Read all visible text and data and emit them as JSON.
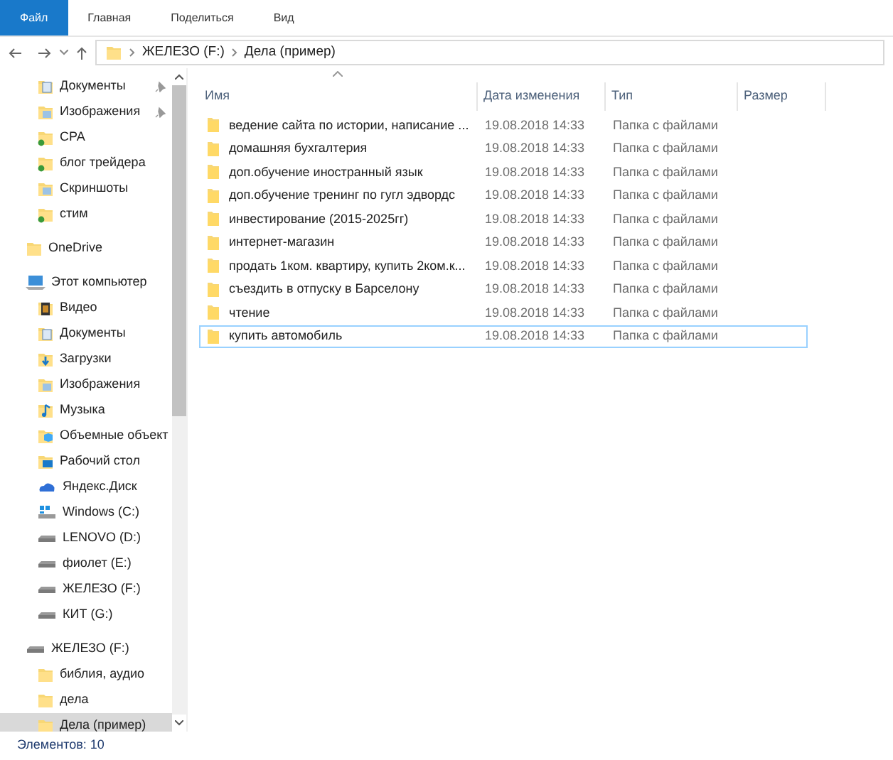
{
  "ribbon_tabs": [
    {
      "label": "Файл",
      "selected": true
    },
    {
      "label": "Главная",
      "selected": false
    },
    {
      "label": "Поделиться",
      "selected": false
    },
    {
      "label": "Вид",
      "selected": false
    }
  ],
  "address_bar": {
    "path": [
      "ЖЕЛЕЗО (F:)",
      "Дела (пример)"
    ]
  },
  "sidebar": {
    "quick_access": [
      {
        "label": "Документы",
        "kind": "docs",
        "pinned": true
      },
      {
        "label": "Изображения",
        "kind": "images",
        "pinned": true
      },
      {
        "label": "CPA",
        "kind": "synced",
        "pinned": false
      },
      {
        "label": "блог трейдера",
        "kind": "synced",
        "pinned": false
      },
      {
        "label": "Скриншоты",
        "kind": "images",
        "pinned": false
      },
      {
        "label": "стим",
        "kind": "synced",
        "pinned": false
      }
    ],
    "tree": [
      {
        "label": "OneDrive",
        "kind": "folder",
        "selected": false
      },
      {
        "label": "Этот компьютер",
        "kind": "pc",
        "selected": false,
        "children": [
          {
            "label": "Видео",
            "kind": "video",
            "selected": false
          },
          {
            "label": "Документы",
            "kind": "docs",
            "selected": false
          },
          {
            "label": "Загрузки",
            "kind": "downloads",
            "selected": false
          },
          {
            "label": "Изображения",
            "kind": "images",
            "selected": false
          },
          {
            "label": "Музыка",
            "kind": "music",
            "selected": false
          },
          {
            "label": "Объемные объект",
            "kind": "objects",
            "selected": false
          },
          {
            "label": "Рабочий стол",
            "kind": "desktop",
            "selected": false
          },
          {
            "label": "Яндекс.Диск",
            "kind": "cloud",
            "selected": false
          },
          {
            "label": "Windows (C:)",
            "kind": "windrive",
            "selected": false
          },
          {
            "label": "LENOVO (D:)",
            "kind": "drive",
            "selected": false
          },
          {
            "label": "фиолет (E:)",
            "kind": "drive",
            "selected": false
          },
          {
            "label": "ЖЕЛЕЗО (F:)",
            "kind": "drive",
            "selected": false
          },
          {
            "label": "КИТ (G:)",
            "kind": "drive",
            "selected": false
          }
        ]
      },
      {
        "label": "ЖЕЛЕЗО (F:)",
        "kind": "drive",
        "selected": false,
        "children": [
          {
            "label": "библия, аудио",
            "kind": "folder",
            "selected": false
          },
          {
            "label": "дела",
            "kind": "folder",
            "selected": false
          },
          {
            "label": "Дела (пример)",
            "kind": "folder",
            "selected": true
          }
        ]
      }
    ]
  },
  "file_list": {
    "columns": [
      "Имя",
      "Дата изменения",
      "Тип",
      "Размер"
    ],
    "rows": [
      {
        "name": "ведение сайта по истории, написание ...",
        "date": "19.08.2018 14:33",
        "type": "Папка с файлами",
        "focused": false
      },
      {
        "name": "домашняя бухгалтерия",
        "date": "19.08.2018 14:33",
        "type": "Папка с файлами",
        "focused": false
      },
      {
        "name": "доп.обучение иностранный язык",
        "date": "19.08.2018 14:33",
        "type": "Папка с файлами",
        "focused": false
      },
      {
        "name": "доп.обучение тренинг по гугл эдвордс",
        "date": "19.08.2018 14:33",
        "type": "Папка с файлами",
        "focused": false
      },
      {
        "name": "инвестирование (2015-2025гг)",
        "date": "19.08.2018 14:33",
        "type": "Папка с файлами",
        "focused": false
      },
      {
        "name": "интернет-магазин",
        "date": "19.08.2018 14:33",
        "type": "Папка с файлами",
        "focused": false
      },
      {
        "name": "продать 1ком. квартиру, купить 2ком.к...",
        "date": "19.08.2018 14:33",
        "type": "Папка с файлами",
        "focused": false
      },
      {
        "name": "съездить в отпуску в Барселону",
        "date": "19.08.2018 14:33",
        "type": "Папка с файлами",
        "focused": false
      },
      {
        "name": "чтение",
        "date": "19.08.2018 14:33",
        "type": "Папка с файлами",
        "focused": false
      },
      {
        "name": "купить автомобиль",
        "date": "19.08.2018 14:33",
        "type": "Папка с файлами",
        "focused": true
      }
    ]
  },
  "status_bar": {
    "item_count": "Элементов: 10"
  }
}
